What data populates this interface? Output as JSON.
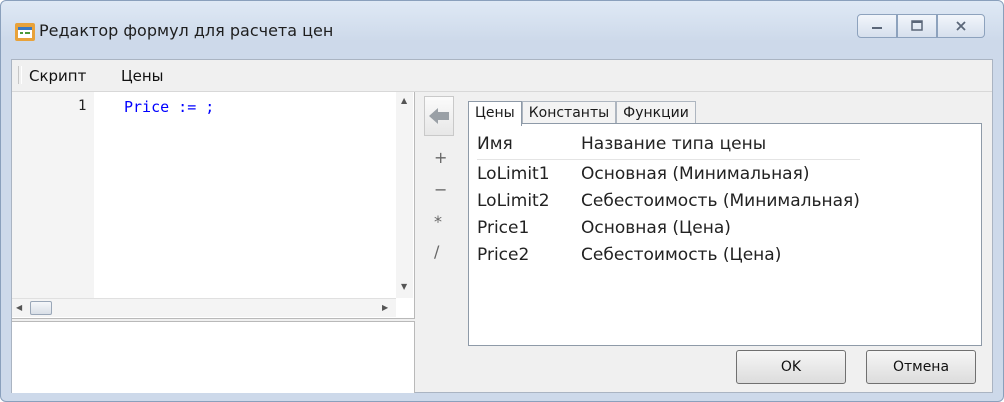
{
  "window": {
    "title": "Редактор формул для расчета цен"
  },
  "menu": {
    "items": [
      "Скрипт",
      "Цены"
    ]
  },
  "editor": {
    "line_number": "1",
    "code": "Price := ;"
  },
  "operators": [
    "+",
    "−",
    "*",
    "/"
  ],
  "tabs": [
    "Цены",
    "Константы",
    "Функции"
  ],
  "active_tab": "Цены",
  "table": {
    "headers": [
      "Имя",
      "Название типа цены"
    ],
    "rows": [
      [
        "LoLimit1",
        "Основная (Минимальная)"
      ],
      [
        "LoLimit2",
        "Себестоимость (Минимальная)"
      ],
      [
        "Price1",
        "Основная (Цена)"
      ],
      [
        "Price2",
        "Себестоимость (Цена)"
      ]
    ]
  },
  "buttons": {
    "ok": "OK",
    "cancel": "Отмена"
  },
  "colors": {
    "code_keyword": "#0000ff",
    "insert_arrow": "#9aa0a6"
  },
  "icons": {
    "app": "formula-editor-icon",
    "insert": "left-arrow-icon"
  }
}
